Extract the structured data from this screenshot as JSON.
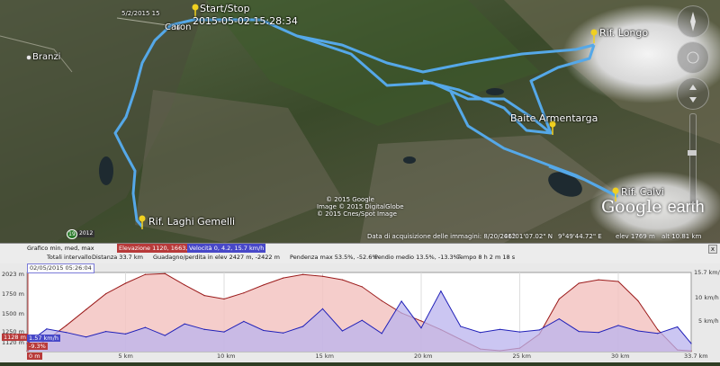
{
  "map": {
    "places": {
      "caron": "Caron",
      "branzi": "Branzi",
      "start_stop": "Start/Stop",
      "start_time": "2015-05-02 15:28:34",
      "small_time": "5/2/2015  15",
      "rif_longo": "Rif. Longo",
      "baite": "Baite Armentarga",
      "rif_calvi": "Rif. Calvi",
      "rif_laghi": "Rif. Laghi Gemelli"
    },
    "copyright": [
      "© 2015 Google",
      "Image © 2015 DigitalGlobe",
      "© 2015 Cnes/Spot Image"
    ],
    "road_badges": [
      "19",
      "2012"
    ],
    "status": {
      "imagery_date": "Data di acquisizione delle immagini: 8/20/2012",
      "lat": "46°01'07.02\" N",
      "lon": "9°49'44.72\" E",
      "elev": "elev  1769 m",
      "alt": "alt  10.81 km"
    },
    "logo_google": "Google",
    "logo_earth": "earth",
    "colors": {
      "track": "#55a8e8",
      "pin": "#f0d020"
    }
  },
  "elevation_panel": {
    "header": {
      "graph_label": "Grafico  min, med, max",
      "elevation": "Elevazione  1120,  1663,  2023 m",
      "speed": "Velocità  0,  4.2,  15.7 km/h",
      "total_interval_label": "Totali intervallo",
      "distance": "Distanza  33.7 km",
      "gain_loss": "Guadagno/perdita in elev  2427 m, -2422 m",
      "slope": "Pendenza max  53.5%, -52.6%",
      "avg_slope": "Pendio medio  13.5%, -13.3%",
      "time": "Tempo  8 h 2 m 18 s",
      "close": "x"
    },
    "cursor_timestamp": "02/05/2015 05:26:04",
    "y_left_labels": [
      "2023 m",
      "1750 m",
      "1500 m",
      "1250 m",
      "1120 m"
    ],
    "y_right_labels": [
      "15.7 km/h",
      "10 km/h",
      "5 km/h"
    ],
    "x_labels": [
      "5 km",
      "10 km",
      "15 km",
      "20 km",
      "25 km",
      "30 km",
      "33.7 km"
    ],
    "x_start_label": "0 m",
    "cursor_elev": "1128 m",
    "cursor_speed": "1.57 km/h",
    "cursor_slope": "-9.3%",
    "colors": {
      "elevation_fill": "#f3c4c2",
      "elevation_line": "#9b1b1b",
      "speed_fill": "#b9b3ee",
      "speed_line": "#2020b8"
    }
  },
  "chart_data": {
    "type": "area",
    "title": "",
    "xlabel": "",
    "ylabel": "",
    "x_unit": "km",
    "xlim": [
      0,
      33.7
    ],
    "series": [
      {
        "name": "Elevazione",
        "unit": "m",
        "ylim": [
          1120,
          2023
        ],
        "x": [
          0,
          1,
          2,
          3,
          4,
          5,
          6,
          7,
          8,
          9,
          10,
          11,
          12,
          13,
          14,
          15,
          16,
          17,
          18,
          19,
          20,
          21,
          22,
          23,
          24,
          25,
          26,
          27,
          28,
          29,
          30,
          31,
          32,
          33,
          33.7
        ],
        "values": [
          1128,
          1250,
          1420,
          1600,
          1780,
          1900,
          2000,
          2010,
          1880,
          1760,
          1720,
          1790,
          1880,
          1960,
          2000,
          1980,
          1940,
          1860,
          1700,
          1560,
          1470,
          1370,
          1260,
          1150,
          1130,
          1160,
          1320,
          1720,
          1900,
          1940,
          1920,
          1700,
          1370,
          1140,
          1128
        ]
      },
      {
        "name": "Velocità",
        "unit": "km/h",
        "ylim": [
          0,
          15.7
        ],
        "x": [
          0,
          1,
          2,
          3,
          4,
          5,
          6,
          7,
          8,
          9,
          10,
          11,
          12,
          13,
          14,
          15,
          16,
          17,
          18,
          19,
          20,
          21,
          22,
          23,
          24,
          25,
          26,
          27,
          28,
          29,
          30,
          31,
          32,
          33,
          33.7
        ],
        "values": [
          1.6,
          4.5,
          3.8,
          2.9,
          4.0,
          3.5,
          4.8,
          3.2,
          5.5,
          4.4,
          3.9,
          6.0,
          4.2,
          3.7,
          5.0,
          8.5,
          4.1,
          6.2,
          3.6,
          10.0,
          4.7,
          12.0,
          5.0,
          3.8,
          4.4,
          3.9,
          4.3,
          6.5,
          4.0,
          3.8,
          5.2,
          4.1,
          3.6,
          4.9,
          1.6
        ]
      }
    ]
  }
}
